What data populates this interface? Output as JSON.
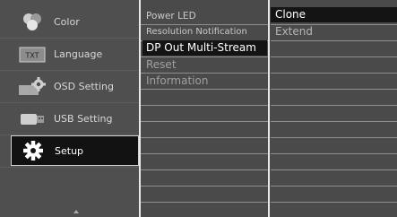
{
  "menu": {
    "items": [
      {
        "label": "Color",
        "icon": "color-wheel-icon"
      },
      {
        "label": "Language",
        "icon": "txt-icon"
      },
      {
        "label": "OSD Setting",
        "icon": "osd-gear-icon"
      },
      {
        "label": "USB Setting",
        "icon": "usb-icon"
      },
      {
        "label": "Setup",
        "icon": "gear-icon",
        "active": true
      }
    ]
  },
  "submenu": {
    "items": [
      {
        "label": "Power LED"
      },
      {
        "label": "Resolution Notification"
      },
      {
        "label": "DP Out Multi-Stream",
        "selected": true
      },
      {
        "label": "Reset"
      },
      {
        "label": "Information"
      }
    ]
  },
  "options": {
    "items": [
      {
        "label": "Clone",
        "selected": true
      },
      {
        "label": "Extend"
      }
    ]
  },
  "colors": {
    "background": "#4a4a4a",
    "selected_bg": "#141414",
    "divider": "#e8e8e8"
  }
}
